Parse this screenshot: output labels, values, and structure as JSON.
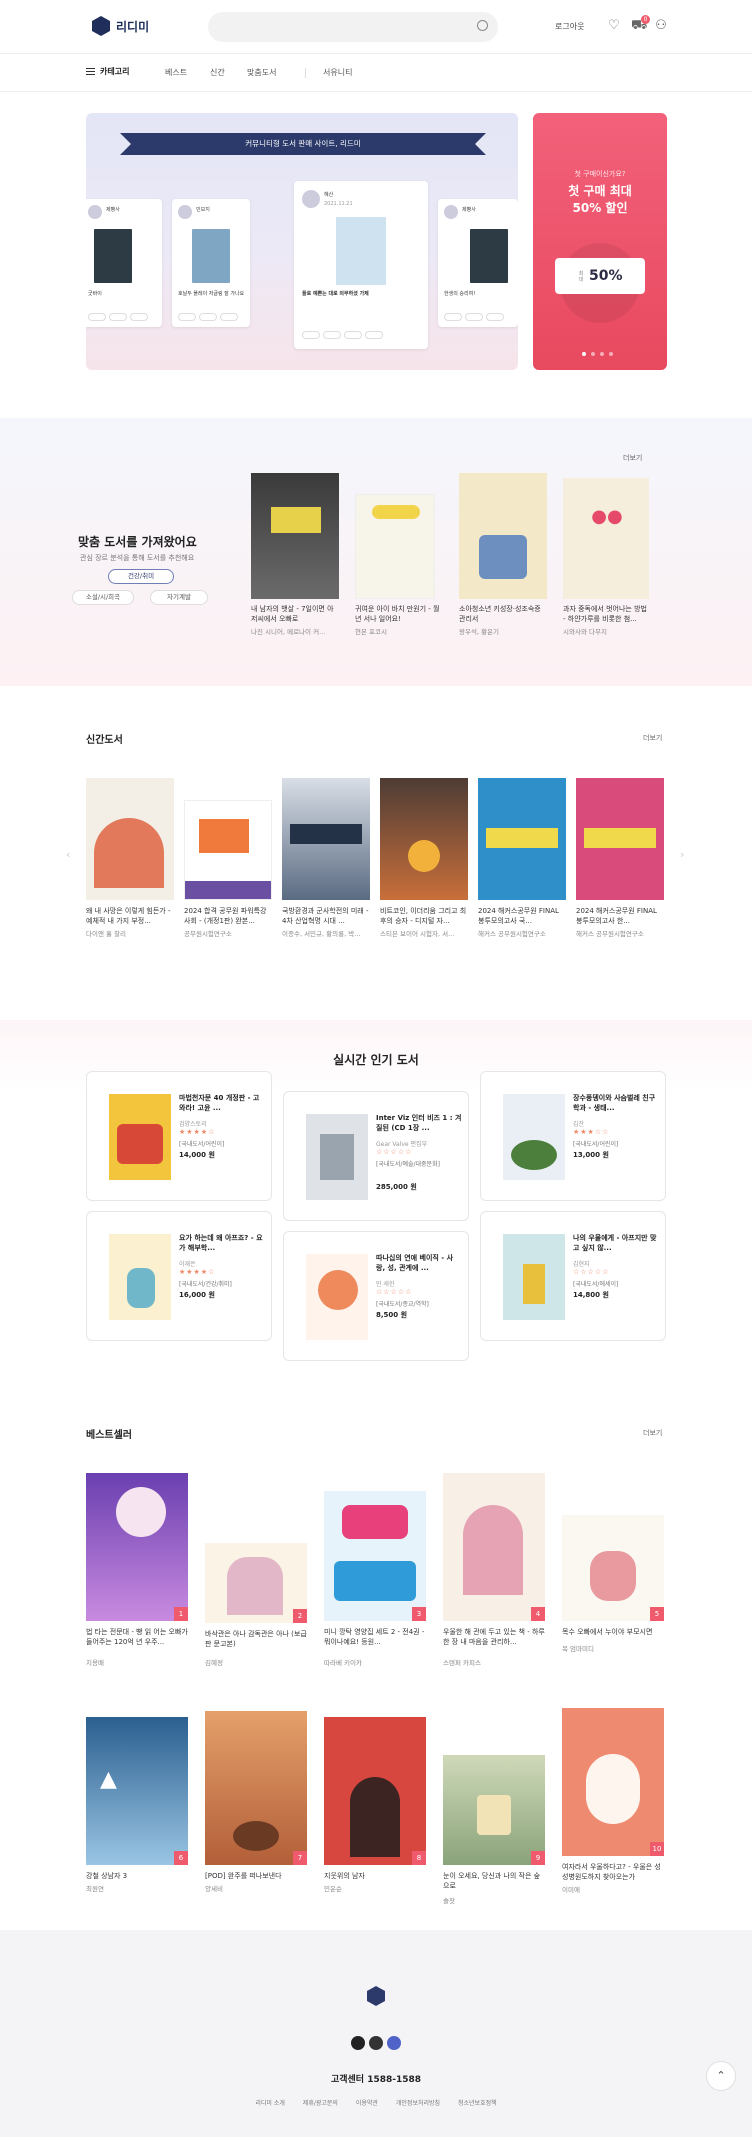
{
  "header": {
    "logo_text": "리디미",
    "login_label": "로그아웃",
    "cart_count": "0"
  },
  "nav": {
    "category_label": "카테고리",
    "items": [
      "베스트",
      "신간",
      "맞춤도서",
      "서유니티"
    ]
  },
  "hero": {
    "ribbon": "커뮤니티형 도서 판매 사이트, 리드미",
    "cards": [
      {
        "name": "제빵사",
        "text": "굿바이"
      },
      {
        "name": "민보지",
        "text": "호날두 플레이 저글링 잘 가나요"
      },
      {
        "name": "혜산",
        "date": "2021.11.21",
        "text": "플로 예쁜는 대로 의무하셨 가제"
      },
      {
        "name": "제빵사",
        "text": "한생의 승리여!"
      }
    ]
  },
  "promo": {
    "subtitle": "첫 구매이신가요?",
    "title_line1": "첫 구매 최대",
    "title_line2": "50% 할인",
    "ticket_small": "최대",
    "ticket_big": "50%",
    "colors": {
      "bg": "#ef5b6d"
    }
  },
  "recommend": {
    "title": "맞춤 도서를 가져왔어요",
    "desc": "관심 장르 분석을 통해 도서를 추천해요",
    "more": "더보기",
    "chips": [
      "건강/취미",
      "소설/시/희곡",
      "자기계발"
    ],
    "books": [
      {
        "title": "내 남자의 뱃살 - 7일이면 아저씨에서 오빠로",
        "author": "나진 시니어, 메로나이 커..."
      },
      {
        "title": "귀여운 아이 바치 만원기 - 월 년 서나 일어요!",
        "author": "현본 포코시"
      },
      {
        "title": "소아청소년 키성장·성조숙증 관리서",
        "author": "왕우석, 황운기"
      },
      {
        "title": "과자 중독에서 벗어나는 방법 - 하얀가루를 비롯한 첨...",
        "author": "시와사와 다무지"
      }
    ]
  },
  "new_books": {
    "title": "신간도서",
    "more": "더보기",
    "books": [
      {
        "title": "왜 내 사망은 이렇게 힘든가 - 예체적 내 가지 부정...",
        "author": "다이앤 홀 찰리"
      },
      {
        "title": "2024 합격 공무원 파워특강 사회 - (개정1판) 완본...",
        "author": "공무원시험연구소"
      },
      {
        "title": "국방환경과 군사학전의 미래 - 4차 산업혁명 시대 ...",
        "author": "이종수, 서민규, 황의룡, 박..."
      },
      {
        "title": "비트코인, 이더리움 그리고 최후의 승자 - 디지털 자...",
        "author": "스티븐 보이어 시험자, 서..."
      },
      {
        "title": "2024 해커스공무원 FINAL 봉투모의고사 국...",
        "author": "해커스 공무원시험연구소"
      },
      {
        "title": "2024 해커스공무원 FINAL 봉투모의고사 한...",
        "author": "해커스 공무원시험연구소"
      }
    ]
  },
  "popular": {
    "title": "실시간 인기 도서",
    "items": [
      {
        "title": "마법천자문 40 개정판 - 고와라! 고윤 ...",
        "author": "검양스토리",
        "category": "[국내도서/어린이]",
        "price": "14,000 원"
      },
      {
        "title": "Inter Viz 인터 비즈 1 : 겨질된 (CD 1장 ...",
        "author": "Gear Valve 편집부",
        "category": "[국내도서/예술/대중문화]",
        "price": "285,000 원"
      },
      {
        "title": "장수풍뎅이와 사슴벌레 친구학과 - 생태...",
        "author": "김잔",
        "category": "[국내도서/어린이]",
        "price": "13,000 원"
      },
      {
        "title": "요가 하는데 왜 아프죠? - 요가 해부학...",
        "author": "이재은",
        "category": "[국내도서/건강/취미]",
        "price": "16,000 원"
      },
      {
        "title": "따나십의 연애 베이직 - 사랑, 성, 관계에 ...",
        "author": "민 세한",
        "category": "[국내도서/종교/역학]",
        "price": "8,500 원"
      },
      {
        "title": "나의 우울에게 - 아프지만 맞고 싶지 않...",
        "author": "김현지",
        "category": "[국내도서/에세이]",
        "price": "14,800 원"
      }
    ]
  },
  "bestseller": {
    "title": "베스트셀러",
    "more": "더보기",
    "books": [
      {
        "title": "법 타는 전문대 - 빵 읽 어는 오빠가 들어주는 120억 년 우주...",
        "author": "지용배",
        "rank": "1"
      },
      {
        "title": "바삭관은 아나 감독관은 아나 (보급판 문고본)",
        "author": "김혜정",
        "rank": "2"
      },
      {
        "title": "미니 깡탁 영양집 세트 2 - 전4권 - 뭐이나예요! 등원...",
        "author": "따라베 키이카",
        "rank": "3"
      },
      {
        "title": "우울한 해 관에 두고 있는 책 - 하루 한 장 내 마음을 관리하...",
        "author": "스텐퍼 카피스",
        "rank": "4"
      },
      {
        "title": "목수 오빠에서 누이야 부모시면",
        "author": "복 엄마미디",
        "rank": "5"
      },
      {
        "title": "강철 상남자 3",
        "author": "최원연",
        "rank": "6"
      },
      {
        "title": "[POD] 완주를 떠나보낸다",
        "author": "양세비",
        "rank": "7"
      },
      {
        "title": "지웃위의 남자",
        "author": "민운순",
        "rank": "8"
      },
      {
        "title": "눈이 오세요, 당신과 나의 작은 숲으로",
        "author": "솔잣",
        "rank": "9"
      },
      {
        "title": "여자라서 우울하다고? - 우울은 성 성병원도하지 찾아오는가",
        "author": "이미애",
        "rank": "10"
      }
    ]
  },
  "footer": {
    "cs": "고객센터 1588-1588",
    "links": [
      "리디미 소개",
      "제휴/광고문의",
      "이용약관",
      "개인정보처리방침",
      "청소년보호정책"
    ]
  }
}
